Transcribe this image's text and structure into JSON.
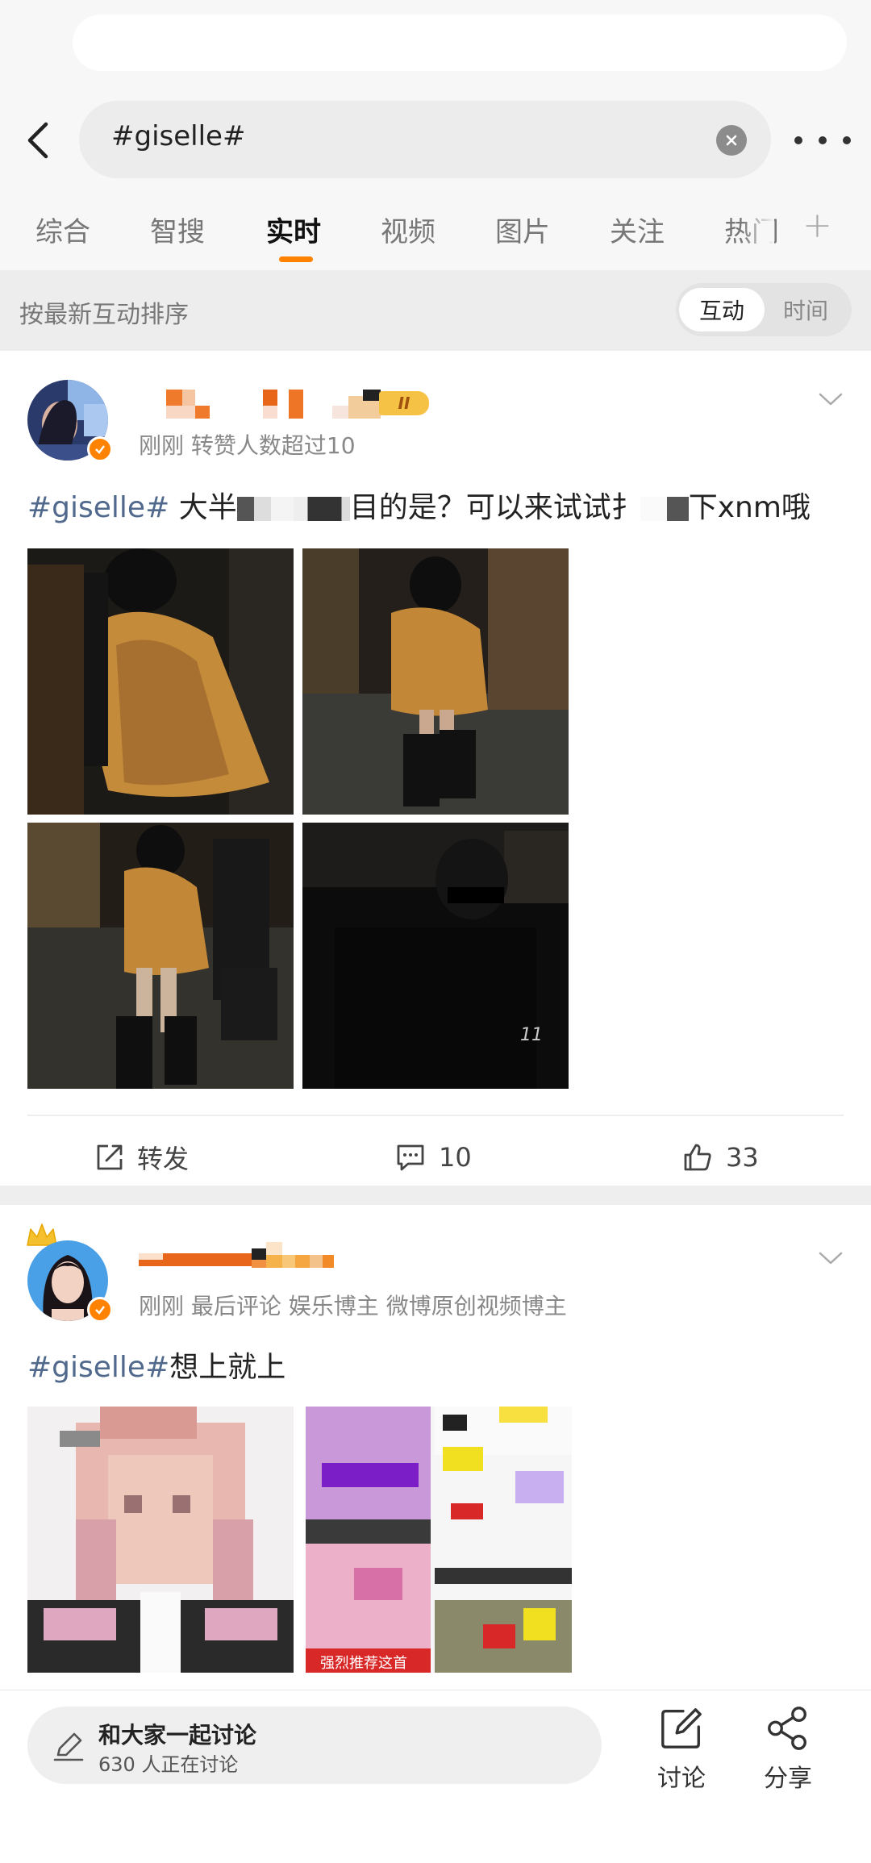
{
  "search": {
    "query": "#giselle#"
  },
  "tabs": [
    {
      "label": "综合"
    },
    {
      "label": "智搜"
    },
    {
      "label": "实时"
    },
    {
      "label": "视频"
    },
    {
      "label": "图片"
    },
    {
      "label": "关注"
    },
    {
      "label": "热门"
    }
  ],
  "active_tab": "实时",
  "sort": {
    "label": "按最新互动排序",
    "options": [
      "互动",
      "时间"
    ],
    "selected": "互动"
  },
  "posts": [
    {
      "meta": "刚刚 转赞人数超过10",
      "badge": "II",
      "hashtag": "#giselle#",
      "text_a": " 大半",
      "text_b": "目的是？可以来试试扌",
      "text_c": "下xnm哦",
      "actions": {
        "repost_label": "转发",
        "comments": "10",
        "likes": "33"
      }
    },
    {
      "meta": "刚刚 最后评论  娱乐博主 微博原创视频博主",
      "hashtag": "#giselle#",
      "text": "想上就上",
      "image_caption": "强烈推荐这首"
    }
  ],
  "bottom": {
    "discuss_title": "和大家一起讨论",
    "discuss_sub": "630 人正在讨论",
    "discuss_btn": "讨论",
    "share_btn": "分享"
  },
  "colors": {
    "accent": "#ff8200",
    "hashtag": "#50698c"
  }
}
